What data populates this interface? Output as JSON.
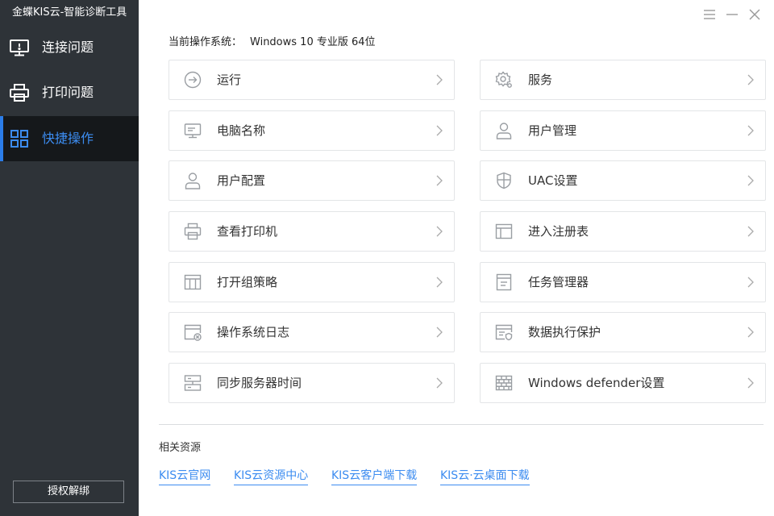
{
  "app": {
    "title": "金蝶KIS云-智能诊断工具"
  },
  "sidebar": {
    "items": [
      {
        "label": "连接问题",
        "icon": "monitor-icon",
        "active": false
      },
      {
        "label": "打印问题",
        "icon": "printer-icon",
        "active": false
      },
      {
        "label": "快捷操作",
        "icon": "grid-icon",
        "active": true
      }
    ],
    "auth_button": "授权解绑"
  },
  "window_controls": {
    "menu": "menu-icon",
    "minimize": "minimize-icon",
    "close": "close-icon"
  },
  "os": {
    "label": "当前操作系统：",
    "value": "Windows 10 专业版 64位"
  },
  "actions": {
    "left": [
      {
        "label": "运行",
        "icon": "run-icon"
      },
      {
        "label": "电脑名称",
        "icon": "computer-icon"
      },
      {
        "label": "用户配置",
        "icon": "user-icon"
      },
      {
        "label": "查看打印机",
        "icon": "printer-icon"
      },
      {
        "label": "打开组策略",
        "icon": "table-icon"
      },
      {
        "label": "操作系统日志",
        "icon": "log-icon"
      },
      {
        "label": "同步服务器时间",
        "icon": "server-icon"
      }
    ],
    "right": [
      {
        "label": "服务",
        "icon": "gear-icon"
      },
      {
        "label": "用户管理",
        "icon": "user-icon"
      },
      {
        "label": "UAC设置",
        "icon": "shield-icon"
      },
      {
        "label": "进入注册表",
        "icon": "window-icon"
      },
      {
        "label": "任务管理器",
        "icon": "task-icon"
      },
      {
        "label": "数据执行保护",
        "icon": "data-protect-icon"
      },
      {
        "label": "Windows defender设置",
        "icon": "firewall-icon"
      }
    ]
  },
  "resources": {
    "title": "相关资源",
    "links": [
      "KIS云官网",
      "KIS云资源中心",
      "KIS云客户端下载",
      "KIS云·云桌面下载"
    ]
  },
  "colors": {
    "sidebar": "#2e3338",
    "active_bg": "#15181b",
    "accent": "#2b7de9",
    "link": "#3c8cf0"
  }
}
